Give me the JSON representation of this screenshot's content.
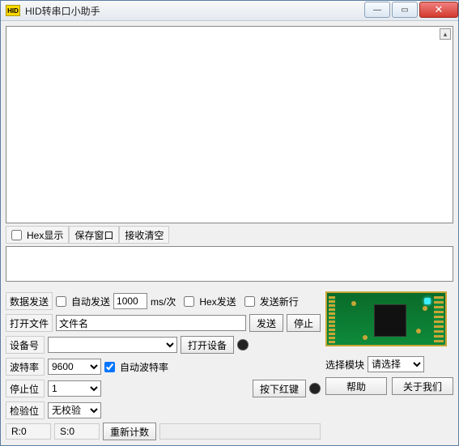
{
  "window": {
    "icon_text": "HID",
    "title": "HID转串口小助手"
  },
  "rx": {
    "hex_display_label": "Hex显示",
    "save_window_label": "保存窗口",
    "clear_rx_label": "接收清空"
  },
  "send": {
    "data_send_label": "数据发送",
    "auto_send_label": "自动发送",
    "interval_value": "1000",
    "interval_unit": "ms/次",
    "hex_send_label": "Hex发送",
    "send_newline_label": "发送新行",
    "open_file_label": "打开文件",
    "file_placeholder": "文件名",
    "send_btn": "发送",
    "stop_btn": "停止"
  },
  "device": {
    "device_num_label": "设备号",
    "open_device_btn": "打开设备",
    "baud_label": "波特率",
    "baud_value": "9600",
    "auto_baud_label": "自动波特率",
    "stop_label": "停止位",
    "stop_value": "1",
    "press_red_btn": "按下红键",
    "parity_label": "检验位",
    "parity_value": "无校验"
  },
  "module": {
    "select_label": "选择模块",
    "select_value": "请选择",
    "help_btn": "帮助",
    "about_btn": "关于我们"
  },
  "status": {
    "r_label": "R:0",
    "s_label": "S:0",
    "reset_count_btn": "重新计数"
  }
}
